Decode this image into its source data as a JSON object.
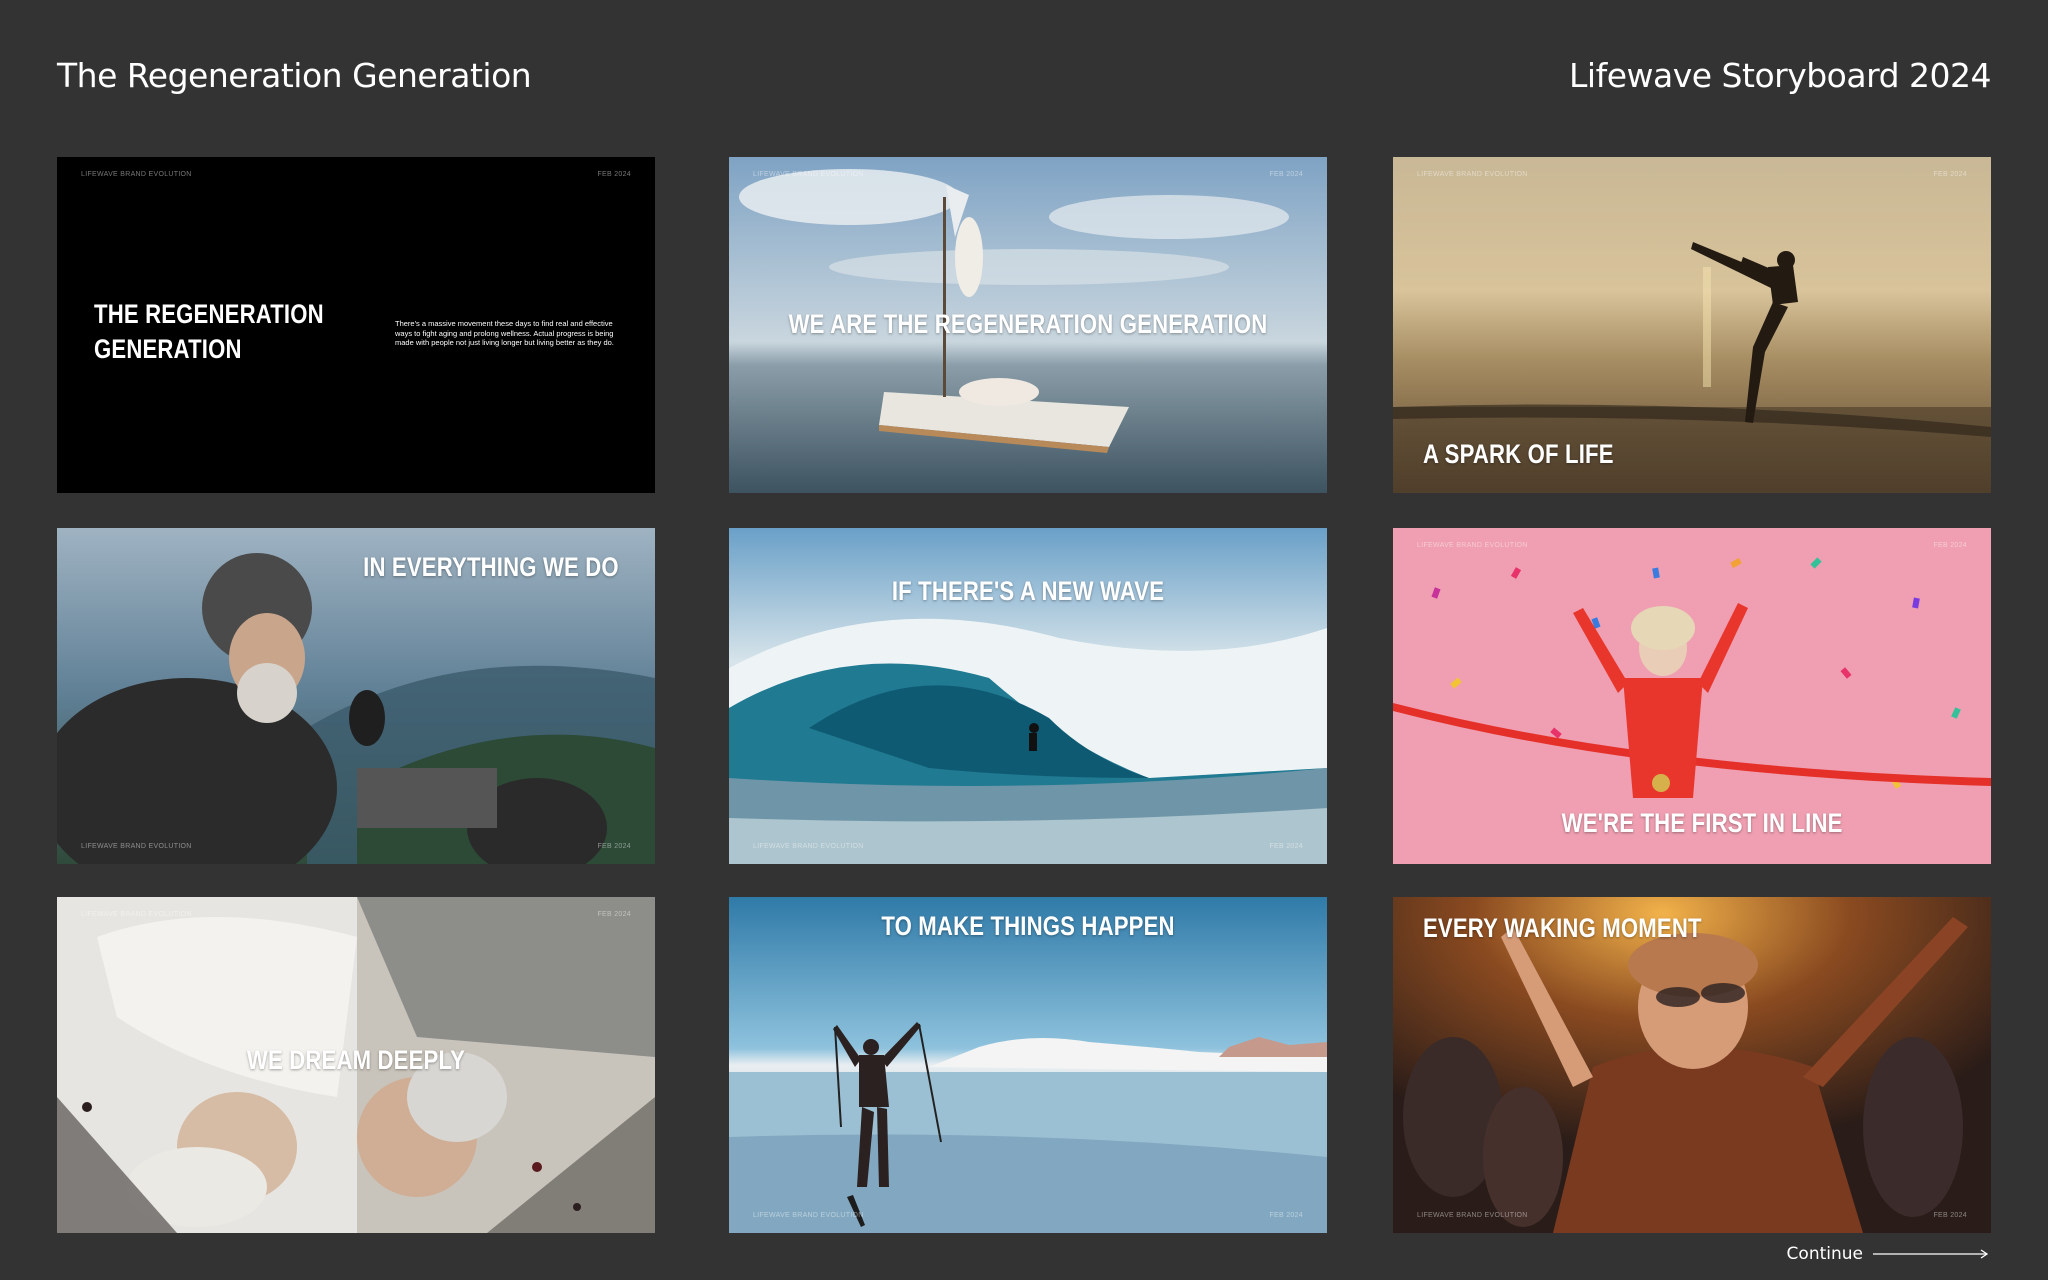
{
  "header": {
    "title": "The Regeneration Generation",
    "subtitle": "Lifewave Storyboard 2024"
  },
  "slide_meta": {
    "brand": "LIFEWAVE BRAND EVOLUTION",
    "date": "FEB 2024"
  },
  "cards": [
    {
      "caption_line1": "THE REGENERATION",
      "caption_line2": "GENERATION",
      "blurb": "There's a massive movement these days to find real and effective ways to fight aging and prolong wellness. Actual progress is being made with people not just living longer but living better as they do.",
      "scene": "black title slide"
    },
    {
      "caption": "WE ARE THE REGENERATION GENERATION",
      "scene": "women on floating raft at sea"
    },
    {
      "caption": "A SPARK OF LIFE",
      "scene": "man kicking on beach at sunset"
    },
    {
      "caption": "IN EVERYTHING WE DO",
      "scene": "bearded motorcyclist in mountains"
    },
    {
      "caption": "IF THERE'S A NEW WAVE",
      "scene": "surfer in barrel wave"
    },
    {
      "caption": "WE'RE THE FIRST IN LINE",
      "scene": "runner breaking finish tape with confetti"
    },
    {
      "caption": "WE DREAM DEEPLY",
      "scene": "older couple lying on floor"
    },
    {
      "caption": "TO MAKE THINGS HAPPEN",
      "scene": "skier on snowfield"
    },
    {
      "caption": "EVERY WAKING MOMENT",
      "scene": "woman cheering at concert"
    }
  ],
  "footer": {
    "continue_label": "Continue"
  },
  "colors": {
    "background": "#333333",
    "text": "#ffffff",
    "confetti_pink": "#ef9fb1"
  }
}
